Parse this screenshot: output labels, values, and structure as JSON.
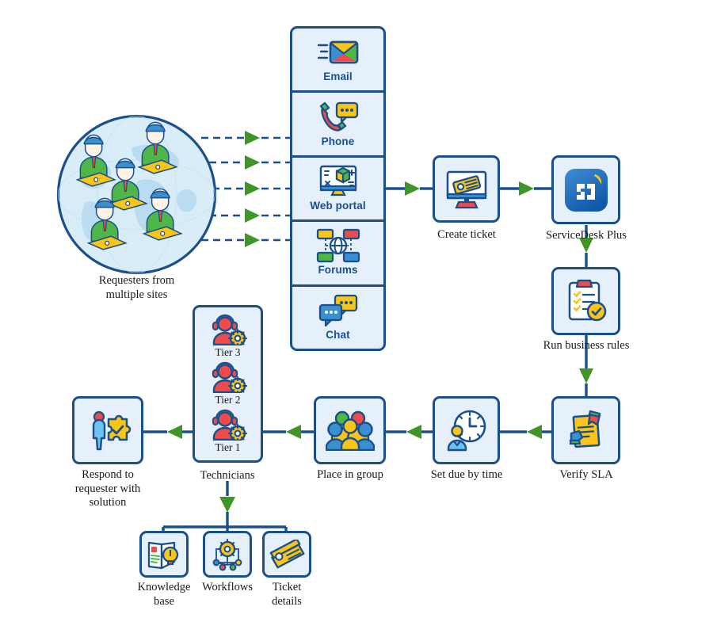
{
  "diagram": {
    "title": "IT service desk ticket lifecycle workflow",
    "colors": {
      "node_border": "#1b4f8a",
      "node_fill": "#e6f0fa",
      "connector": "#1b4f8a",
      "arrowhead": "#3f9626",
      "label_text": "#1a1a1a",
      "channel_label": "#17508f",
      "globe_fill": "#d8ecf8",
      "accent_red": "#ef4b4b",
      "accent_yellow": "#f9c518",
      "accent_green": "#5cb531",
      "accent_blue": "#3a8fd0"
    },
    "requesters": {
      "label_line1": "Requesters from",
      "label_line2": "multiple sites",
      "name": "globe-with-requesters",
      "person_count": 5,
      "dashed_arrow_count": 5
    },
    "channels": [
      {
        "label": "Email",
        "icon": "email-icon"
      },
      {
        "label": "Phone",
        "icon": "phone-icon"
      },
      {
        "label": "Web portal",
        "icon": "web-portal-icon"
      },
      {
        "label": "Forums",
        "icon": "forums-icon"
      },
      {
        "label": "Chat",
        "icon": "chat-icon"
      }
    ],
    "nodes": {
      "create_ticket": {
        "label": "Create ticket",
        "icon": "monitor-ticket-icon"
      },
      "servicedesk_plus": {
        "label": "ServiceDesk Plus",
        "icon": "servicedesk-plus-logo"
      },
      "run_business_rules": {
        "label": "Run business rules",
        "icon": "clipboard-check-icon"
      },
      "verify_sla": {
        "label": "Verify SLA",
        "icon": "sla-document-hands-icon"
      },
      "set_due_by_time": {
        "label": "Set due by time",
        "icon": "clock-person-icon"
      },
      "place_in_group": {
        "label": "Place in group",
        "icon": "group-people-icon"
      },
      "respond": {
        "label_line1": "Respond to",
        "label_line2": "requester with",
        "label_line3": "solution",
        "icon": "person-puzzle-check-icon"
      }
    },
    "technicians": {
      "label": "Technicians",
      "tiers": [
        {
          "label": "Tier 3",
          "icon": "technician-gear-icon"
        },
        {
          "label": "Tier 2",
          "icon": "technician-gear-icon"
        },
        {
          "label": "Tier 1",
          "icon": "technician-gear-icon"
        }
      ]
    },
    "resources": [
      {
        "label_line1": "Knowledge",
        "label_line2": "base",
        "icon": "knowledge-base-icon"
      },
      {
        "label_line1": "Workflows",
        "label_line2": "",
        "icon": "workflow-gear-icon"
      },
      {
        "label_line1": "Ticket",
        "label_line2": "details",
        "icon": "ticket-details-icon"
      }
    ]
  }
}
